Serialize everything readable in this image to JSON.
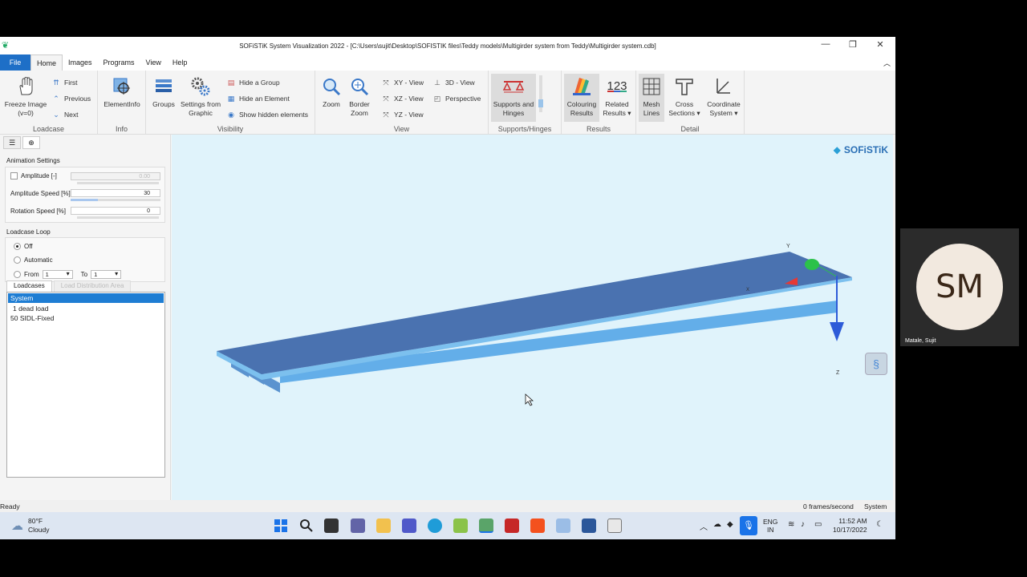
{
  "window": {
    "title": "SOFiSTiK System Visualization 2022 - [C:\\Users\\sujit\\Desktop\\SOFISTIK files\\Teddy models\\Multigirder system from Teddy\\Multigirder system.cdb]",
    "minimize": "—",
    "maximize": "❐",
    "close": "✕"
  },
  "menu": [
    "File",
    "Home",
    "Images",
    "Programs",
    "View",
    "Help"
  ],
  "ribbon": {
    "loadcase": {
      "label": "Loadcase",
      "freeze": "Freeze Image",
      "freeze_sub": "(v=0)",
      "first": "First",
      "previous": "Previous",
      "next": "Next"
    },
    "info": {
      "label": "Info",
      "element_info": "ElementInfo"
    },
    "visibility": {
      "label": "Visibility",
      "groups": "Groups",
      "settings1": "Settings from",
      "settings2": "Graphic",
      "hide_group": "Hide a Group",
      "hide_element": "Hide an Element",
      "show_hidden": "Show hidden elements"
    },
    "view": {
      "label": "View",
      "zoom": "Zoom",
      "border1": "Border",
      "border2": "Zoom",
      "xy": "XY - View",
      "xz": "XZ - View",
      "yz": "YZ - View",
      "v3d": "3D - View",
      "perspective": "Perspective"
    },
    "supports": {
      "label": "Supports/Hinges",
      "btn1": "Supports and",
      "btn2": "Hinges"
    },
    "results": {
      "label": "Results",
      "colouring1": "Colouring",
      "colouring2": "Results",
      "related_icon": "123",
      "related1": "Related",
      "related2": "Results"
    },
    "detail": {
      "label": "Detail",
      "mesh1": "Mesh",
      "mesh2": "Lines",
      "cross1": "Cross",
      "cross2": "Sections",
      "coord1": "Coordinate",
      "coord2": "System"
    }
  },
  "panel": {
    "animation_title": "Animation Settings",
    "amplitude_label": "Amplitude [-]",
    "amplitude_value": "0.00",
    "amp_speed_label": "Amplitude Speed [%]",
    "amp_speed_value": "30",
    "amp_speed_level": 0.3,
    "rotation_label": "Rotation Speed [%]",
    "rotation_value": "0",
    "loop_title": "Loadcase Loop",
    "off": "Off",
    "automatic": "Automatic",
    "from": "From",
    "from_value": "1",
    "to": "To",
    "to_value": "1",
    "tab_loadcases": "Loadcases",
    "tab_lda": "Load Distribution Area",
    "items": [
      "System",
      "1 dead load",
      "50 SIDL-Fixed"
    ]
  },
  "viewport": {
    "logo": "SOFiSTiK",
    "axis_y": "Y",
    "axis_x": "X",
    "axis_z": "Z"
  },
  "status": {
    "left": "Ready",
    "fps": "0 frames/second",
    "right": "System"
  },
  "taskbar": {
    "temp": "80°F",
    "weather": "Cloudy",
    "lang1": "ENG",
    "lang2": "IN",
    "time": "11:52 AM",
    "date": "10/17/2022"
  },
  "video": {
    "initials": "SM",
    "name": "Matale, Sujit"
  },
  "colors": {
    "accent": "#1e6fc7",
    "deck": "#4a72b0",
    "girder": "#5aa6e8",
    "viewport_bg": "#e0f3fb"
  }
}
